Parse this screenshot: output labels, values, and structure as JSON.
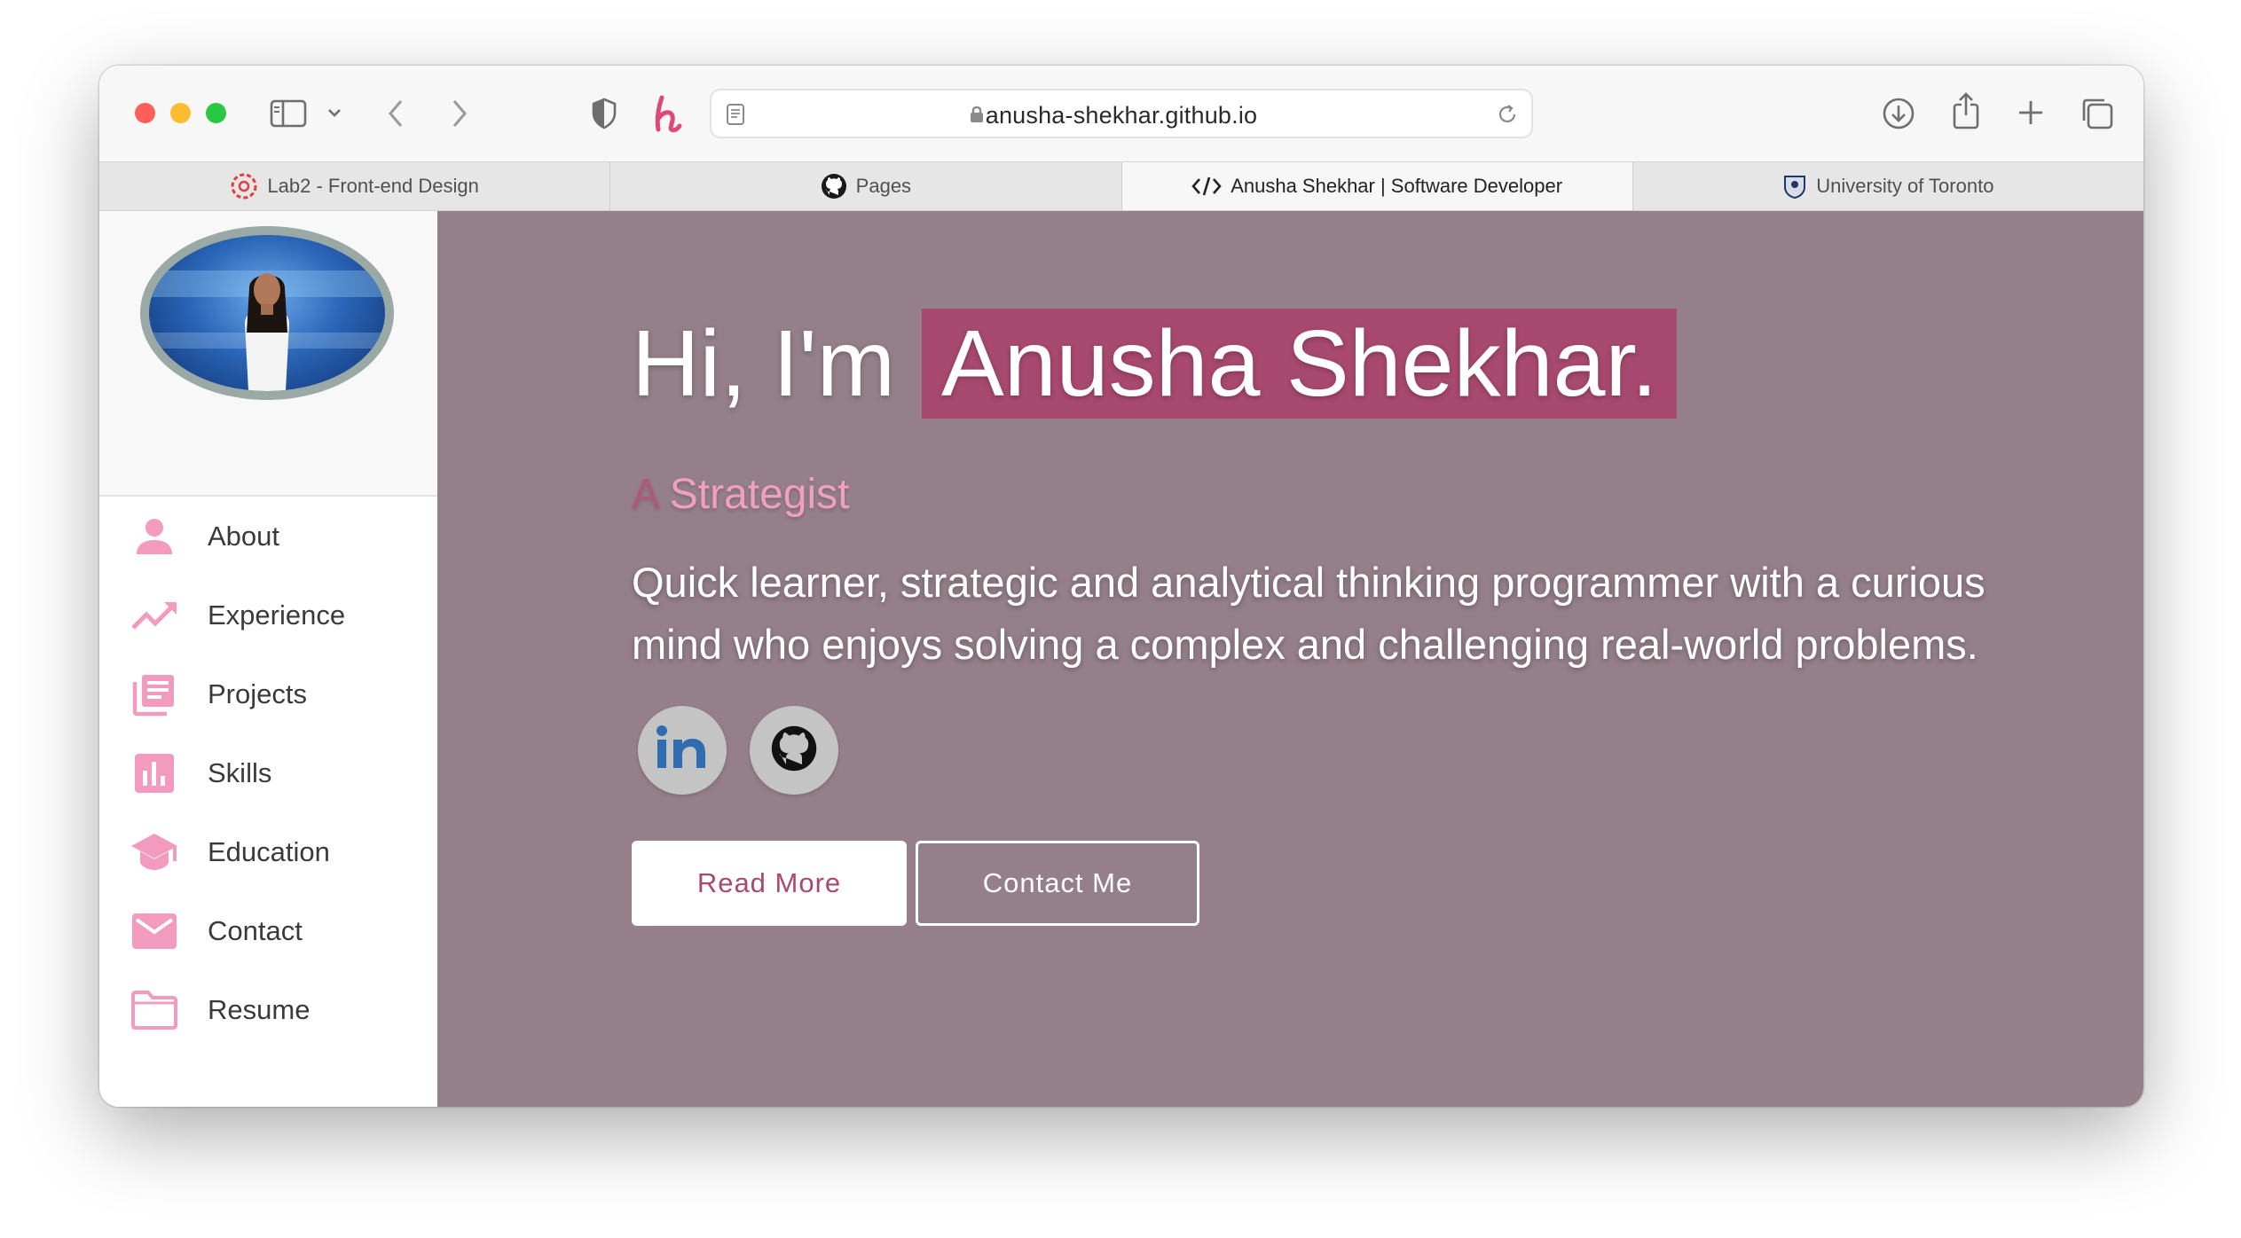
{
  "browser": {
    "url": "anusha-shekhar.github.io",
    "tabs": [
      {
        "label": "Lab2 - Front-end Design",
        "icon": "canvas-logo-icon",
        "active": false
      },
      {
        "label": "Pages",
        "icon": "github-icon",
        "active": false
      },
      {
        "label": "Anusha Shekhar | Software Developer",
        "icon": "code-icon",
        "active": true
      },
      {
        "label": "University of Toronto",
        "icon": "uoft-crest-icon",
        "active": false
      }
    ]
  },
  "sidebar": {
    "nav": [
      {
        "label": "About",
        "icon": "person-icon"
      },
      {
        "label": "Experience",
        "icon": "trending-up-icon"
      },
      {
        "label": "Projects",
        "icon": "library-books-icon"
      },
      {
        "label": "Skills",
        "icon": "bar-chart-icon"
      },
      {
        "label": "Education",
        "icon": "graduation-cap-icon"
      },
      {
        "label": "Contact",
        "icon": "mail-icon"
      },
      {
        "label": "Resume",
        "icon": "folder-icon"
      }
    ]
  },
  "hero": {
    "greeting": "Hi, I'm",
    "name": "Anusha Shekhar.",
    "role_typed": "A",
    "role": "Strategist",
    "tagline": "Quick learner, strategic and analytical thinking programmer with a curious mind who enjoys solving a complex and challenging real-world problems.",
    "social": [
      {
        "name": "LinkedIn",
        "icon": "linkedin-icon"
      },
      {
        "name": "GitHub",
        "icon": "github-icon"
      }
    ],
    "read_more": "Read More",
    "contact_me": "Contact Me"
  },
  "colors": {
    "accent": "#a8496f",
    "pink": "#ef9fc0",
    "main_bg": "#957f89",
    "nav_icon": "#f29bbf"
  }
}
